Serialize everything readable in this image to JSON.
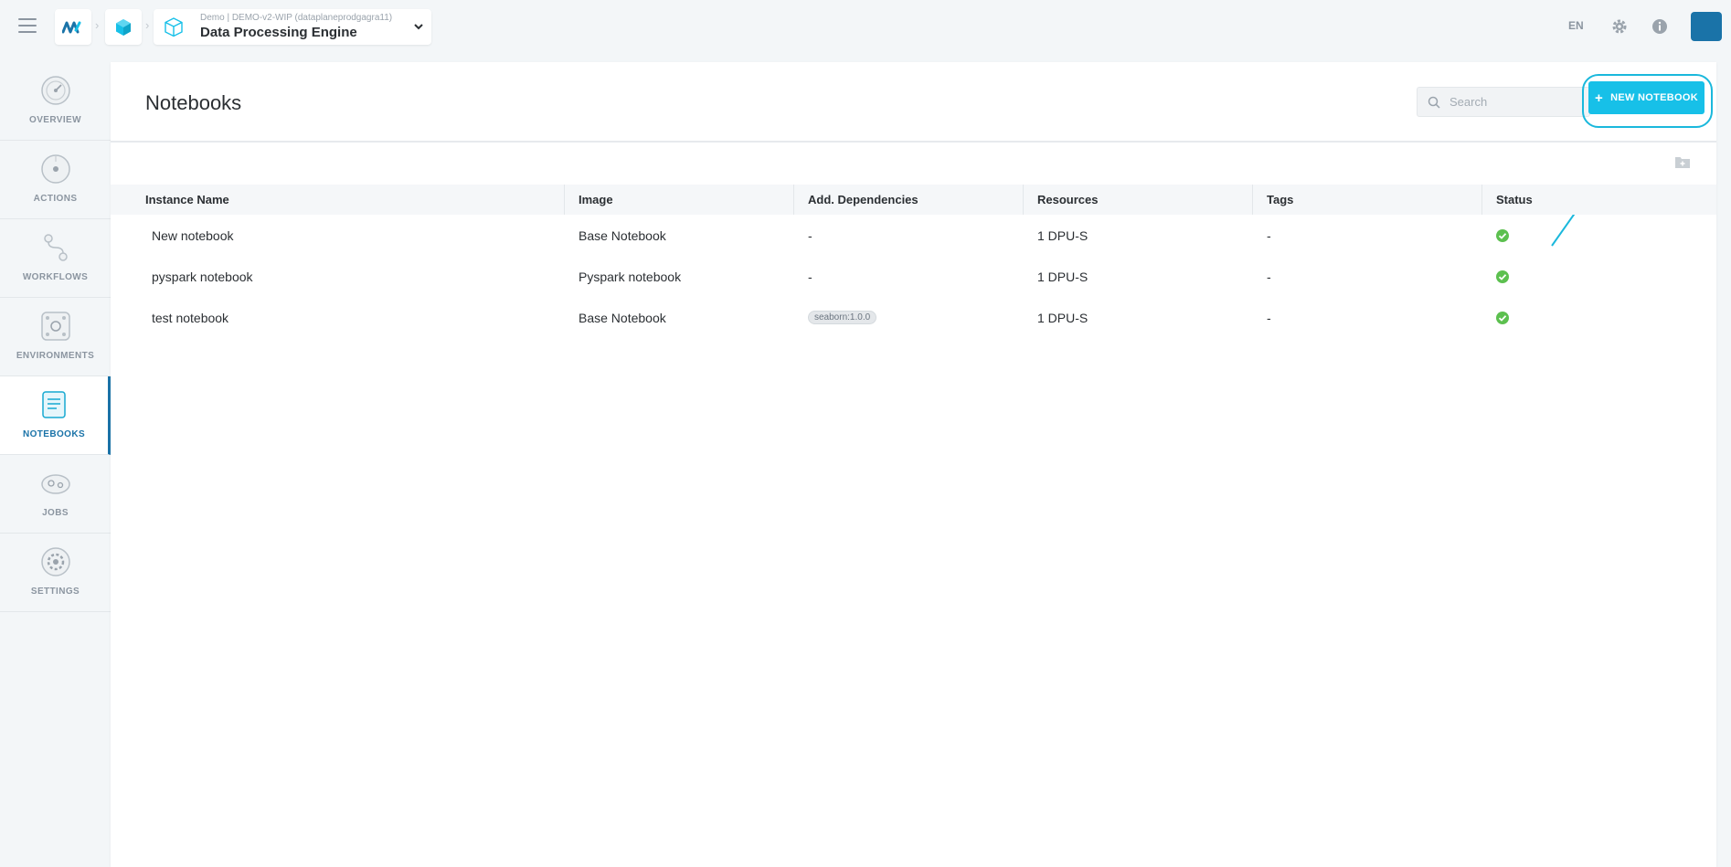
{
  "topbar": {
    "menu_icon": "hamburger-icon",
    "breadcrumb": {
      "subtitle": "Demo | DEMO-v2-WIP (dataplaneprodgagra11)",
      "title": "Data Processing Engine"
    },
    "language": "EN",
    "colors": {
      "brand": "#17c0e8",
      "avatar": "#1a73a8"
    }
  },
  "sidebar": {
    "items": [
      {
        "label": "OVERVIEW",
        "icon": "overview-gauge-icon"
      },
      {
        "label": "ACTIONS",
        "icon": "actions-circle-icon"
      },
      {
        "label": "WORKFLOWS",
        "icon": "workflows-flow-icon"
      },
      {
        "label": "ENVIRONMENTS",
        "icon": "environments-network-icon"
      },
      {
        "label": "NOTEBOOKS",
        "icon": "notebook-icon",
        "active": true
      },
      {
        "label": "JOBS",
        "icon": "jobs-cloud-icon"
      },
      {
        "label": "SETTINGS",
        "icon": "settings-gear-icon"
      }
    ]
  },
  "main": {
    "title": "Notebooks",
    "search": {
      "placeholder": "Search",
      "value": ""
    },
    "new_button": {
      "label": "NEW NOTEBOOK",
      "icon": "plus-icon"
    },
    "table": {
      "columns": [
        "Instance Name",
        "Image",
        "Add. Dependencies",
        "Resources",
        "Tags",
        "Status"
      ],
      "rows": [
        {
          "name": "New notebook",
          "image": "Base Notebook",
          "deps": "-",
          "resources": "1 DPU-S",
          "tags": "-",
          "status": "running"
        },
        {
          "name": "pyspark notebook",
          "image": "Pyspark notebook",
          "deps": "-",
          "resources": "1 DPU-S",
          "tags": "-",
          "status": "running"
        },
        {
          "name": "test notebook",
          "image": "Base Notebook",
          "deps_tag": "seaborn:1.0.0",
          "resources": "1 DPU-S",
          "tags": "-",
          "status": "running"
        }
      ]
    }
  }
}
